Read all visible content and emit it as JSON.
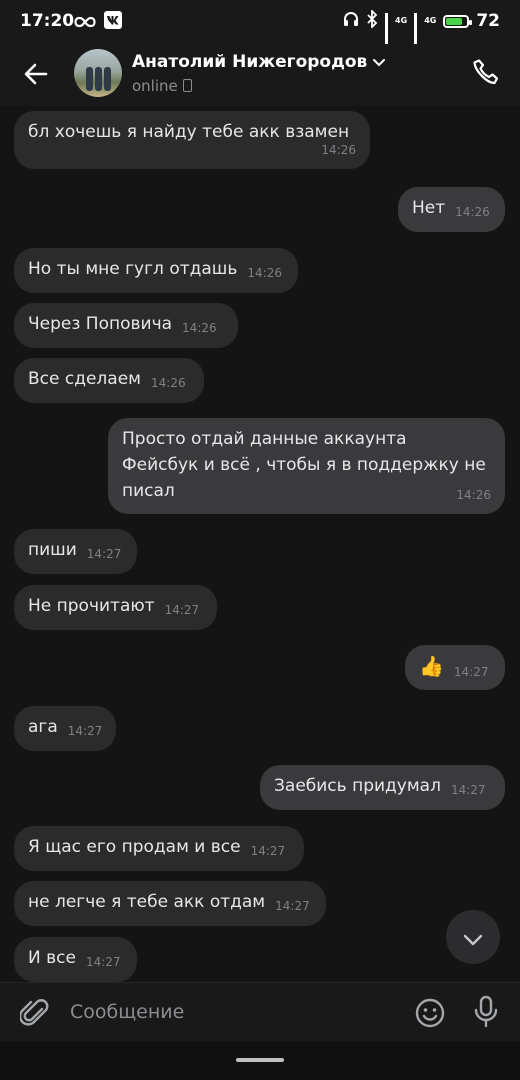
{
  "status_bar": {
    "time": "17:20",
    "network_1": "4G",
    "network_2": "4G",
    "battery": "72",
    "icons": [
      "infinity-icon",
      "vk-icon",
      "headphones-icon",
      "bluetooth-icon",
      "signal-icon",
      "signal-icon",
      "battery-icon"
    ]
  },
  "header": {
    "name": "Анатолий Нижегородов",
    "status": "online"
  },
  "messages": [
    {
      "dir": "in",
      "text": "бл хочешь я найду тебе акк взамен",
      "time": "14:26"
    },
    {
      "dir": "out",
      "text": "Нет",
      "time": "14:26"
    },
    {
      "dir": "in",
      "text": "Но ты мне гугл отдашь",
      "time": "14:26"
    },
    {
      "dir": "in",
      "text": "Через Поповича",
      "time": "14:26"
    },
    {
      "dir": "in",
      "text": "Все сделаем",
      "time": "14:26"
    },
    {
      "dir": "out",
      "text": "Просто отдай данные аккаунта Фейсбук и всё , чтобы я в поддержку не писал",
      "time": "14:26"
    },
    {
      "dir": "in",
      "text": "пиши",
      "time": "14:27"
    },
    {
      "dir": "in",
      "text": "Не прочитают",
      "time": "14:27"
    },
    {
      "dir": "out",
      "text": "👍",
      "time": "14:27"
    },
    {
      "dir": "in",
      "text": "ага",
      "time": "14:27"
    },
    {
      "dir": "out",
      "text": "Заебись придумал",
      "time": "14:27"
    },
    {
      "dir": "in",
      "text": "Я щас его продам и все",
      "time": "14:27"
    },
    {
      "dir": "in",
      "text": "не легче я тебе акк отдам",
      "time": "14:27"
    },
    {
      "dir": "in",
      "text": "И все",
      "time": "14:27"
    }
  ],
  "composer": {
    "placeholder": "Сообщение"
  },
  "colors": {
    "background": "#141414",
    "incoming_bubble": "#2b2b2c",
    "outgoing_bubble": "#3a3a3c"
  }
}
